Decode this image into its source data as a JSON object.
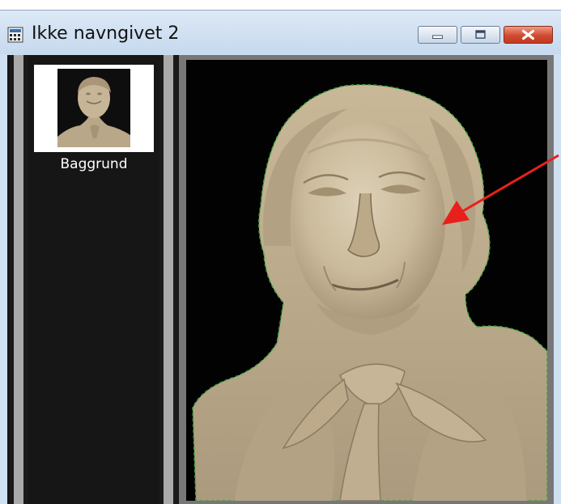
{
  "window": {
    "title": "Ikke navngivet 2",
    "buttons": [
      "minimize-icon",
      "maximize-icon",
      "close-icon"
    ]
  },
  "layers": {
    "items": [
      {
        "label": "Baggrund",
        "selected": true
      }
    ]
  },
  "canvas": {
    "image": "bust-of-man-portrait",
    "selection": "marching-ants-around-bust"
  },
  "annotation": {
    "type": "arrow",
    "color": "#e8201c"
  },
  "colors": {
    "titlebar": "#cfe0f1",
    "close_button": "#cf4b2f",
    "filmstrip": "#161616",
    "selection_outline": "#3d9a3d"
  }
}
